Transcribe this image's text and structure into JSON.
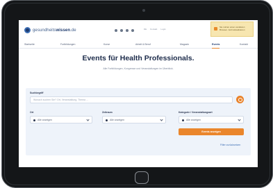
{
  "header": {
    "logo": {
      "brand_light": "gesundheits",
      "brand_bold": "wissen",
      "brand_suffix": ".de"
    },
    "links": [
      "DE",
      "Kontakt",
      "Login"
    ],
    "notice": {
      "text": "Sie nutzen einen veralteten Browser. Jetzt aktualisieren"
    }
  },
  "nav": {
    "items": [
      "Startseite",
      "Fortbildungen",
      "Kurse",
      "Arbeit & Beruf",
      "Magazin",
      "Events",
      "Kontakt"
    ],
    "active": "Events"
  },
  "hero": {
    "title": "Events für Health Professionals.",
    "subtitle": "Alle Fortbildungen, Kongresse und Veranstaltungen im Überblick."
  },
  "search": {
    "label": "Suchbegriff",
    "placeholder": "Wonach suchen Sie? Ort, Veranstaltung, Thema ...",
    "filters": [
      {
        "label": "Ort",
        "value": "Alle anzeigen"
      },
      {
        "label": "Zeitraum",
        "value": "Alle anzeigen"
      },
      {
        "label": "Kategorie / Veranstaltungsart",
        "value": "Alle anzeigen"
      }
    ],
    "submit_label": "Events anzeigen",
    "reset_label": "Filter zurücksetzen"
  }
}
